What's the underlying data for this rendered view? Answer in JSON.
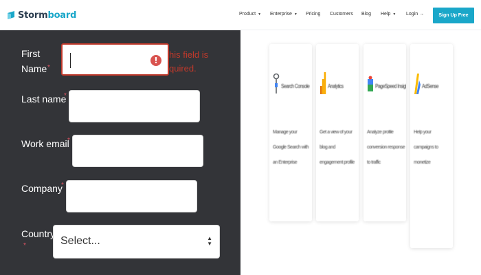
{
  "header": {
    "logo_text_a": "Storm",
    "logo_text_b": "board",
    "nav": [
      {
        "label": "Product",
        "has_caret": true
      },
      {
        "label": "Enterprise",
        "has_caret": true
      },
      {
        "label": "Pricing",
        "has_caret": false
      },
      {
        "label": "Customers",
        "has_caret": false
      },
      {
        "label": "Blog",
        "has_caret": false
      },
      {
        "label": "Help",
        "has_caret": true
      },
      {
        "label": "Login →",
        "has_caret": false
      }
    ],
    "signup_label": "Sign Up Free",
    "accent_color": "#1aa7c9"
  },
  "form": {
    "first_name_line1": "First",
    "first_name_line2": "Name",
    "first_name_value": "",
    "error_line1": "his field is",
    "error_line2": "quired.",
    "last_name_label": "Last name",
    "work_email_label": "Work email",
    "company_label": "Company",
    "country_label": "Country",
    "country_value": "Select...",
    "required_mark": "*",
    "panel_color": "#333438",
    "error_color": "#c0392b"
  },
  "cards": [
    {
      "title": "Search Console",
      "description": "Manage your Google Search with an Enterprise",
      "icon": "magnifier-icon"
    },
    {
      "title": "Analytics",
      "description": "Get a view of your blog and engagement profile",
      "icon": "bar-chart-icon"
    },
    {
      "title": "PageSpeed Insights",
      "description": "Analyze profile conversion response to traffic",
      "icon": "speed-icon"
    },
    {
      "title": "AdSense",
      "description": "Help your campaigns to monetize",
      "icon": "adsense-icon"
    }
  ]
}
